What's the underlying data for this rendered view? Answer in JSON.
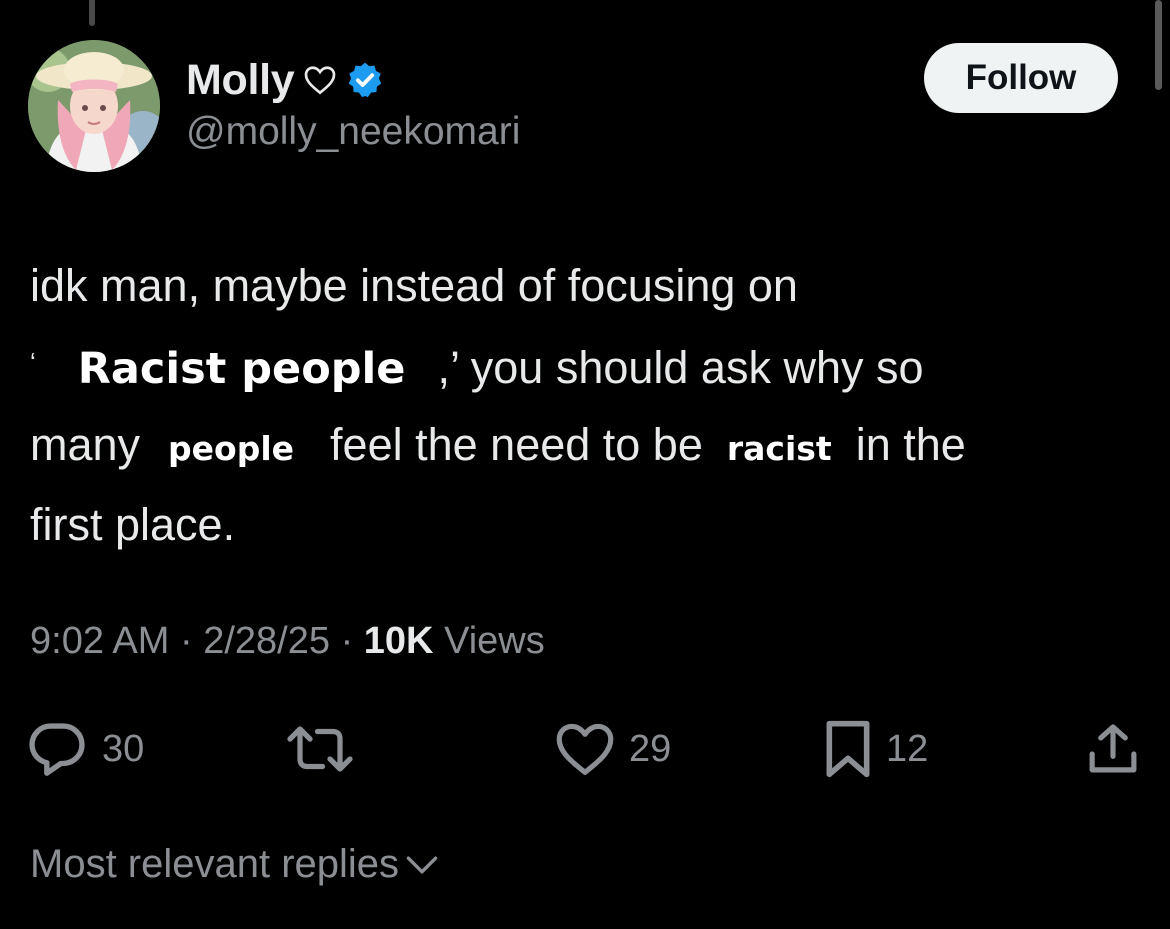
{
  "author": {
    "display_name": "Molly",
    "handle": "@molly_neekomari",
    "verified": true,
    "name_icon": "heart-outline-icon",
    "verified_color": "#1d9bf0"
  },
  "follow_button": {
    "label": "Follow"
  },
  "tweet": {
    "line1": "idk man, maybe instead of focusing on",
    "open_quote": "‘",
    "phrase_1": "Racist people",
    "close_quote_rest": ",’ you should ask why so",
    "many": "many",
    "phrase_2": "people",
    "middle": "feel the need to be",
    "phrase_3": "racist",
    "in_the": "in the",
    "line4": "first place."
  },
  "meta": {
    "time": "9:02 AM",
    "date": "2/28/25",
    "separator": "·",
    "views_count": "10K",
    "views_label": "Views"
  },
  "actions": {
    "reply_count": "30",
    "repost_count": "",
    "like_count": "29",
    "bookmark_count": "12"
  },
  "replies_sort": {
    "label": "Most relevant replies"
  },
  "colors": {
    "background": "#000000",
    "text": "#e7e9ea",
    "muted": "#8b8f94",
    "follow_bg": "#eff3f4"
  }
}
